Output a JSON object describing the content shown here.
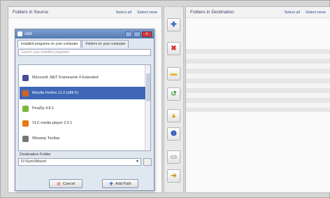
{
  "left_panel": {
    "title": "Folders in Source",
    "select_all": "Select all",
    "select_none": "Select none"
  },
  "right_panel": {
    "title": "Folders in Destination",
    "select_all": "Select all",
    "select_none": "Select none"
  },
  "middle_buttons": [
    {
      "icon": "plus-icon",
      "glyph": "✚",
      "color": "#2b67c9"
    },
    {
      "icon": "remove-icon",
      "glyph": "✖",
      "color": "#d32f2f"
    },
    {
      "icon": "folder-icon",
      "glyph": "▬",
      "color": "#e5b931"
    },
    {
      "icon": "refresh-icon",
      "glyph": "↺",
      "color": "#3e9a3e"
    },
    {
      "icon": "folder-up-icon",
      "glyph": "▲",
      "color": "#e0a820"
    },
    {
      "icon": "info-icon",
      "glyph": "❷",
      "color": "#2b58b5"
    },
    {
      "icon": "disk-icon",
      "glyph": "▭",
      "color": "#9e9e9e"
    },
    {
      "icon": "move-icon",
      "glyph": "➜",
      "color": "#c9941a"
    }
  ],
  "dialog": {
    "title": "Add",
    "tabs": [
      "Installed programs on your computer",
      "Folders on your computer"
    ],
    "search_placeholder": "Search your installed programs",
    "items": [
      {
        "label": "Microsoft .NET Framework 4 Extended",
        "selected": false,
        "icon_color": "#4a4a9a"
      },
      {
        "label": "Mozilla Firefox 11.0 (x86 fr)",
        "selected": true,
        "icon_color": "#d0621f"
      },
      {
        "label": "PeaZip 4.8.1",
        "selected": false,
        "icon_color": "#7cb83a"
      },
      {
        "label": "VLC media player 2.0.1",
        "selected": false,
        "icon_color": "#e77a10"
      },
      {
        "label": "Winamp Toolbar",
        "selected": false,
        "icon_color": "#777777"
      }
    ],
    "destination_label": "Destination Folder",
    "destination_value": "D:\\Sync\\Mount",
    "cancel_label": "Cancel",
    "add_label": "Add Path"
  }
}
